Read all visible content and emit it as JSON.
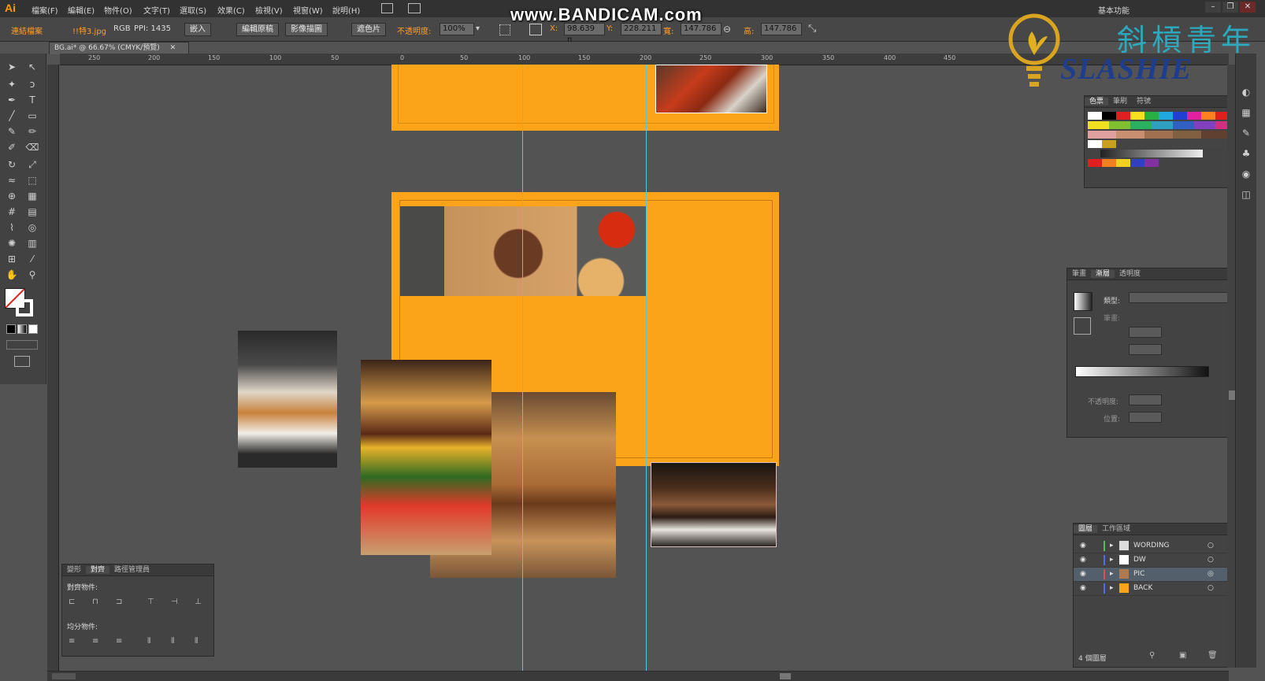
{
  "app": {
    "logo": "Ai",
    "workspace": "基本功能"
  },
  "menu": [
    "檔案(F)",
    "編輯(E)",
    "物件(O)",
    "文字(T)",
    "選取(S)",
    "效果(C)",
    "檢視(V)",
    "視窗(W)",
    "說明(H)"
  ],
  "window_controls": [
    "–",
    "❐",
    "✕"
  ],
  "watermark": {
    "recorder": "www.BANDICAM.com",
    "brand_cn": "斜槓青年",
    "brand_en": "SLASHIE"
  },
  "control": {
    "linked_file": "連結檔案",
    "filename": "!!特3.jpg",
    "colormode": "RGB",
    "ppi": "PPI: 1435",
    "embed": "嵌入",
    "edit_original": "編輯原稿",
    "image_trace": "影像描圖",
    "mask": "遮色片",
    "opacity_label": "不透明度:",
    "opacity": "100%",
    "x_label": "X:",
    "x": "98.639 n",
    "y_label": "Y:",
    "y": "228.211",
    "w_label": "寬:",
    "w": "147.786",
    "h_label": "高:",
    "h": "147.786"
  },
  "doc_tab": "BG.ai* @ 66.67% (CMYK/預覽)",
  "ruler_h": [
    "250",
    "200",
    "150",
    "100",
    "50",
    "0",
    "50",
    "100",
    "150",
    "200",
    "250",
    "300",
    "350",
    "400",
    "450"
  ],
  "swatches_panel": {
    "tabs": [
      "色票",
      "筆刷",
      "符號"
    ]
  },
  "gradient_panel": {
    "tabs": [
      "筆畫",
      "漸層",
      "透明度"
    ],
    "type_label": "類型:",
    "stroke_label": "筆畫:",
    "opacity_label": "不透明度:",
    "location_label": "位置:"
  },
  "align_panel": {
    "tabs": [
      "變形",
      "對齊",
      "路徑管理員"
    ],
    "align_label": "對齊物件:",
    "distribute_label": "均分物件:"
  },
  "layers_panel": {
    "tabs": [
      "圖層",
      "工作區域"
    ],
    "layers": [
      {
        "name": "WORDING",
        "color": "#4fc24f"
      },
      {
        "name": "DW",
        "color": "#4a6cf7"
      },
      {
        "name": "PIC",
        "color": "#e24b4b"
      },
      {
        "name": "BACK",
        "color": "#4a6cf7"
      }
    ],
    "count": "4 個圖層"
  }
}
